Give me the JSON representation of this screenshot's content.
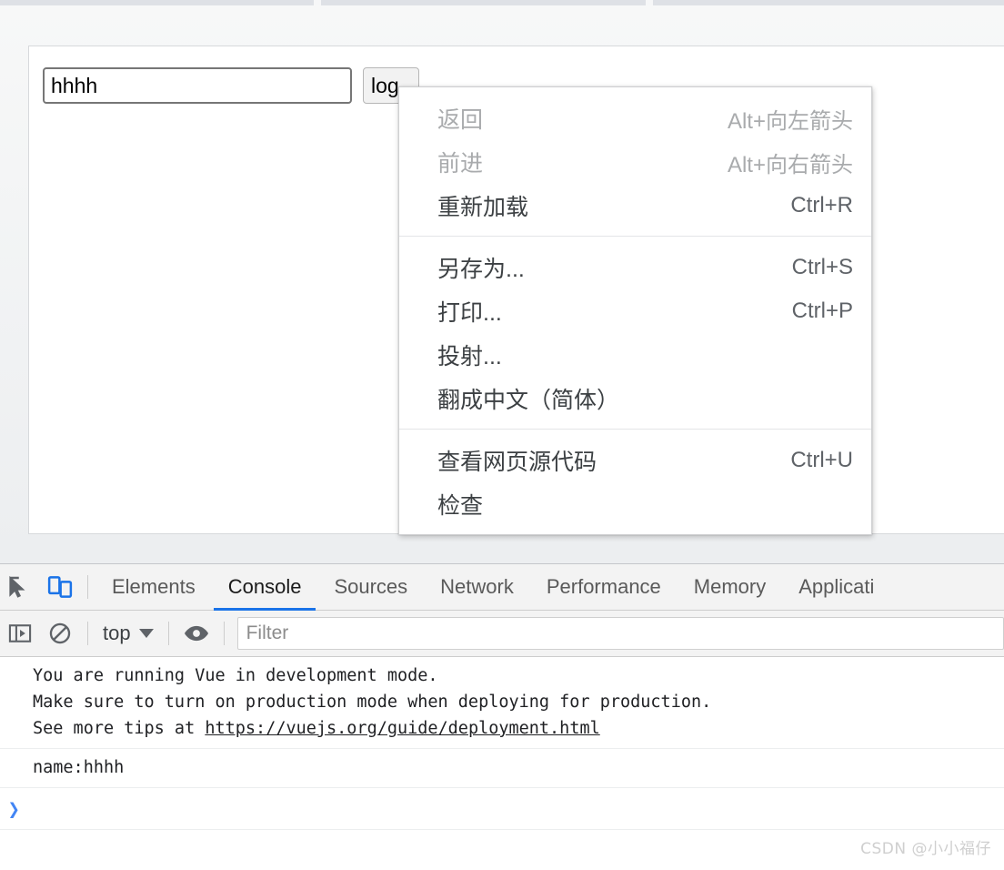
{
  "browser": {
    "chrome_strip_color": "#dee1e6"
  },
  "webpage": {
    "name_input": {
      "value": "hhhh",
      "placeholder": ""
    },
    "log_button": {
      "label": "log"
    }
  },
  "context_menu": {
    "groups": [
      {
        "items": [
          {
            "label": "返回",
            "accel": "Alt+向左箭头",
            "disabled": true
          },
          {
            "label": "前进",
            "accel": "Alt+向右箭头",
            "disabled": true
          },
          {
            "label": "重新加载",
            "accel": "Ctrl+R",
            "disabled": false
          }
        ]
      },
      {
        "items": [
          {
            "label": "另存为...",
            "accel": "Ctrl+S",
            "disabled": false
          },
          {
            "label": "打印...",
            "accel": "Ctrl+P",
            "disabled": false
          },
          {
            "label": "投射...",
            "accel": "",
            "disabled": false
          },
          {
            "label": "翻成中文（简体）",
            "accel": "",
            "disabled": false
          }
        ]
      },
      {
        "items": [
          {
            "label": "查看网页源代码",
            "accel": "Ctrl+U",
            "disabled": false
          },
          {
            "label": "检查",
            "accel": "",
            "disabled": false
          }
        ]
      }
    ]
  },
  "devtools": {
    "icons": {
      "inspect": "inspect-element-icon",
      "device": "device-toolbar-icon",
      "sidebar": "console-sidebar-icon",
      "clear": "clear-console-icon",
      "eye": "live-expression-icon"
    },
    "tabs": [
      {
        "label": "Elements",
        "active": false
      },
      {
        "label": "Console",
        "active": true
      },
      {
        "label": "Sources",
        "active": false
      },
      {
        "label": "Network",
        "active": false
      },
      {
        "label": "Performance",
        "active": false
      },
      {
        "label": "Memory",
        "active": false
      },
      {
        "label": "Applicati",
        "active": false
      }
    ],
    "active_tab_underline_color": "#1a73e8",
    "toolbar": {
      "context_selector": "top",
      "filter_placeholder": "Filter",
      "filter_value": ""
    },
    "console": {
      "messages": [
        {
          "lines": [
            "You are running Vue in development mode.",
            "Make sure to turn on production mode when deploying for production.",
            "See more tips at "
          ],
          "link": "https://vuejs.org/guide/deployment.html"
        },
        {
          "lines": [
            "name:hhhh"
          ],
          "link": ""
        }
      ],
      "prompt_symbol": "❯",
      "prompt_color": "#4285f4"
    }
  },
  "watermark": {
    "text": "CSDN @小小福仔"
  }
}
